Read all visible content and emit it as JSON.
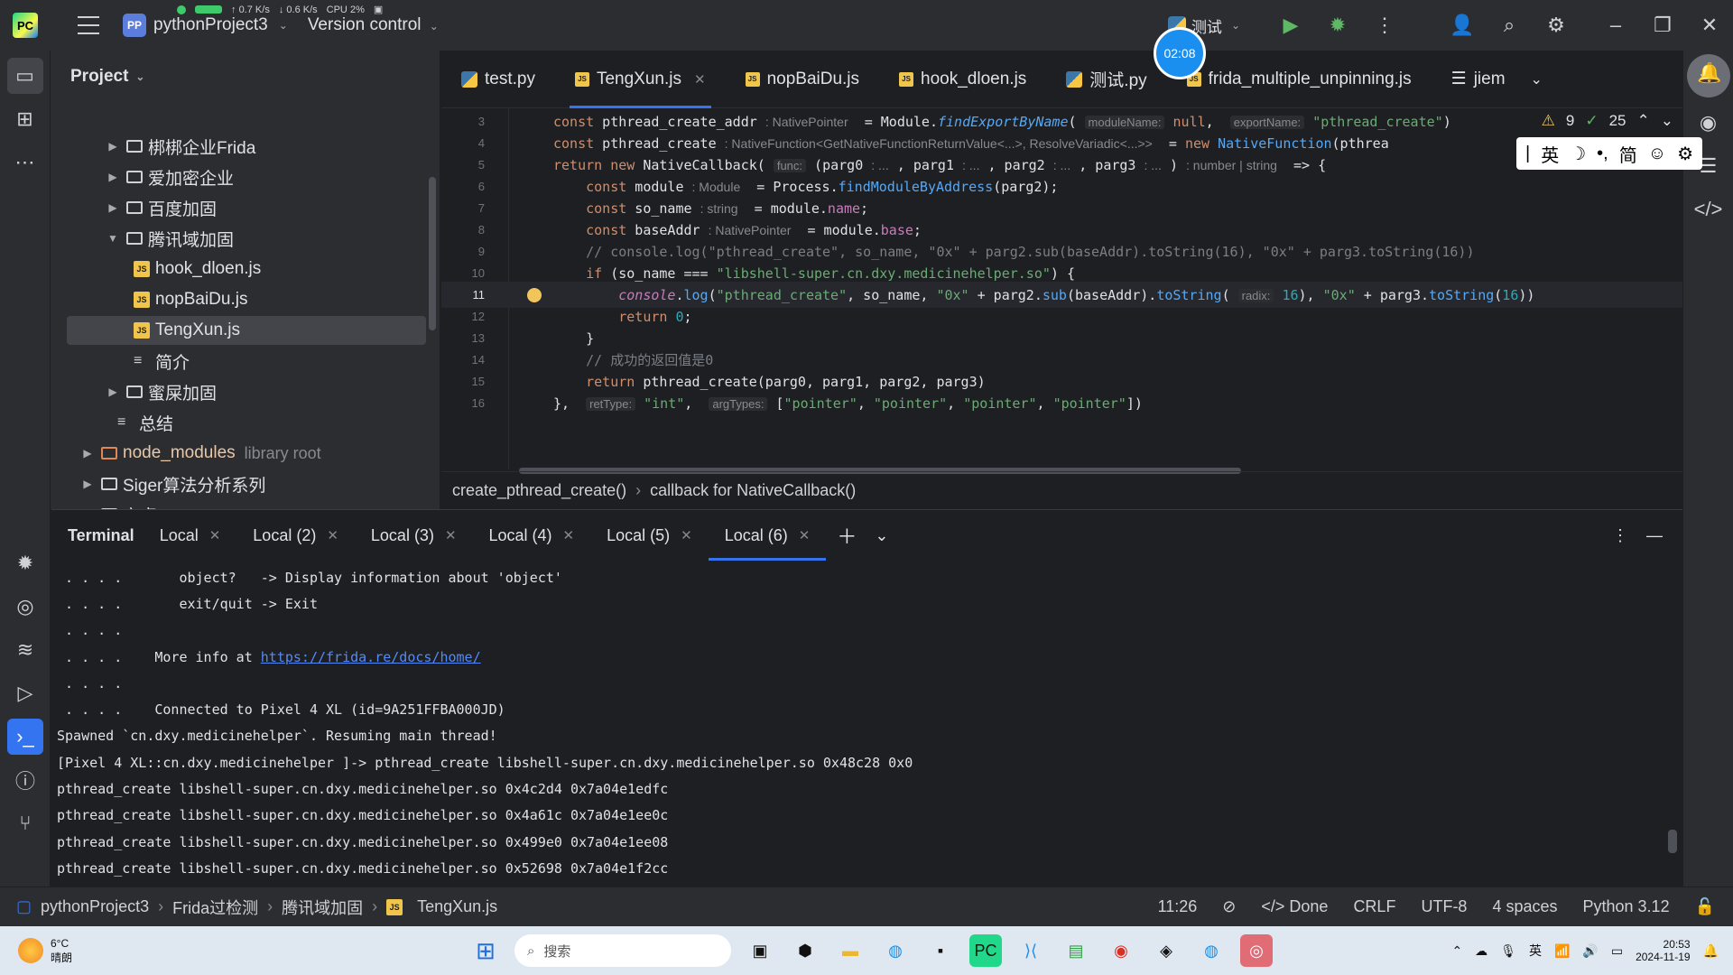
{
  "titlebar": {
    "project_initials": "PP",
    "project_name": "pythonProject3",
    "version_control": "Version control",
    "stats": {
      "up": "0.7",
      "down": "0.6",
      "unit": "K/s",
      "cpu_label": "CPU",
      "cpu": "2%"
    },
    "run_config": "测试",
    "timer": "02:08"
  },
  "project_panel": {
    "title": "Project",
    "tree": [
      {
        "label": "梆梆企业Frida",
        "type": "folder",
        "expand": "▶"
      },
      {
        "label": "爱加密企业",
        "type": "folder",
        "expand": "▶"
      },
      {
        "label": "百度加固",
        "type": "folder",
        "expand": "▶"
      },
      {
        "label": "腾讯域加固",
        "type": "folder",
        "expand": "▼"
      },
      {
        "label": "hook_dloen.js",
        "type": "js"
      },
      {
        "label": "nopBaiDu.js",
        "type": "js"
      },
      {
        "label": "TengXun.js",
        "type": "js",
        "selected": true
      },
      {
        "label": "简介",
        "type": "text"
      },
      {
        "label": "蜜屎加固",
        "type": "folder",
        "expand": "▶"
      },
      {
        "label": "总结",
        "type": "text"
      },
      {
        "label": "node_modules",
        "type": "folder-orange",
        "expand": "▶",
        "note": "library root"
      },
      {
        "label": "Siger算法分析系列",
        "type": "folder",
        "expand": "▶"
      },
      {
        "label": "安卓",
        "type": "folder",
        "expand": "▶"
      }
    ]
  },
  "editor": {
    "tabs": [
      {
        "label": "test.py",
        "kind": "py"
      },
      {
        "label": "TengXun.js",
        "kind": "js",
        "active": true
      },
      {
        "label": "nopBaiDu.js",
        "kind": "js"
      },
      {
        "label": "hook_dloen.js",
        "kind": "js"
      },
      {
        "label": "测试.py",
        "kind": "py"
      },
      {
        "label": "frida_multiple_unpinning.js",
        "kind": "js"
      },
      {
        "label": "jiem",
        "kind": "list"
      }
    ],
    "inspections": {
      "warnings": "9",
      "ok": "25"
    },
    "line_numbers": [
      "3",
      "4",
      "5",
      "6",
      "7",
      "8",
      "9",
      "10",
      "11",
      "12",
      "13",
      "14",
      "15",
      "16"
    ],
    "current_line": "11",
    "breadcrumb": [
      "create_pthread_create()",
      "callback for NativeCallback()"
    ]
  },
  "ime": {
    "lang": "英",
    "mode": "简"
  },
  "terminal": {
    "title": "Terminal",
    "tabs": [
      "Local",
      "Local (2)",
      "Local (3)",
      "Local (4)",
      "Local (5)",
      "Local (6)"
    ],
    "active_tab": "Local (6)",
    "lines": [
      " . . . .       object?   -> Display information about 'object'",
      " . . . .       exit/quit -> Exit",
      " . . . .",
      " . . . .    More info at ",
      " . . . .",
      " . . . .    Connected to Pixel 4 XL (id=9A251FFBA000JD)",
      "Spawned `cn.dxy.medicinehelper`. Resuming main thread!",
      "[Pixel 4 XL::cn.dxy.medicinehelper ]-> pthread_create libshell-super.cn.dxy.medicinehelper.so 0x48c28 0x0",
      "pthread_create libshell-super.cn.dxy.medicinehelper.so 0x4c2d4 0x7a04e1edfc",
      "pthread_create libshell-super.cn.dxy.medicinehelper.so 0x4a61c 0x7a04e1ee0c",
      "pthread_create libshell-super.cn.dxy.medicinehelper.so 0x499e0 0x7a04e1ee08",
      "pthread_create libshell-super.cn.dxy.medicinehelper.so 0x52698 0x7a04e1f2cc"
    ],
    "link": "https://frida.re/docs/home/"
  },
  "statusbar": {
    "crumbs": [
      "pythonProject3",
      "Frida过检测",
      "腾讯域加固",
      "TengXun.js"
    ],
    "position": "11:26",
    "done": "Done",
    "line_sep": "CRLF",
    "encoding": "UTF-8",
    "indent": "4 spaces",
    "interpreter": "Python 3.12"
  },
  "taskbar": {
    "weather_temp": "6°C",
    "weather_desc": "晴朗",
    "search_placeholder": "搜索",
    "ime": "英",
    "time": "20:53",
    "date": "2024-11-19"
  }
}
